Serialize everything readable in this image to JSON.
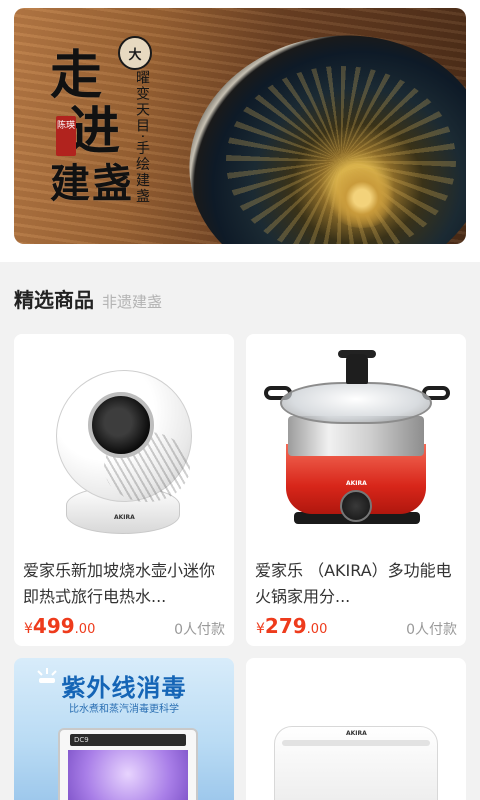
{
  "banner": {
    "calligraphy_lines": [
      "走",
      "进",
      "建盏"
    ],
    "seal_text": "陈瑛",
    "logo_text": "大",
    "vertical_text": "曜变天目·手绘建盏"
  },
  "section": {
    "title": "精选商品",
    "subtitle": "非遗建盏"
  },
  "products": [
    {
      "title": "爱家乐新加坡烧水壶小迷你即热式旅行电热水...",
      "currency": "¥",
      "price_int": "499",
      "price_dec": ".00",
      "sold": "0人付款",
      "image_brand": "AKIRA"
    },
    {
      "title": "爱家乐 （AKIRA）多功能电火锅家用分...",
      "currency": "¥",
      "price_int": "279",
      "price_dec": ".00",
      "sold": "0人付款",
      "image_brand": "AKIRA"
    },
    {
      "promo_title": "紫外线消毒",
      "promo_subtitle": "比水煮和蒸汽消毒更科学",
      "panel_text": "DC9"
    },
    {
      "image_brand": "AKIRA"
    }
  ],
  "colors": {
    "price": "#ee3b1c",
    "background": "#f2f2f2",
    "promo_blue": "#1565b6"
  }
}
